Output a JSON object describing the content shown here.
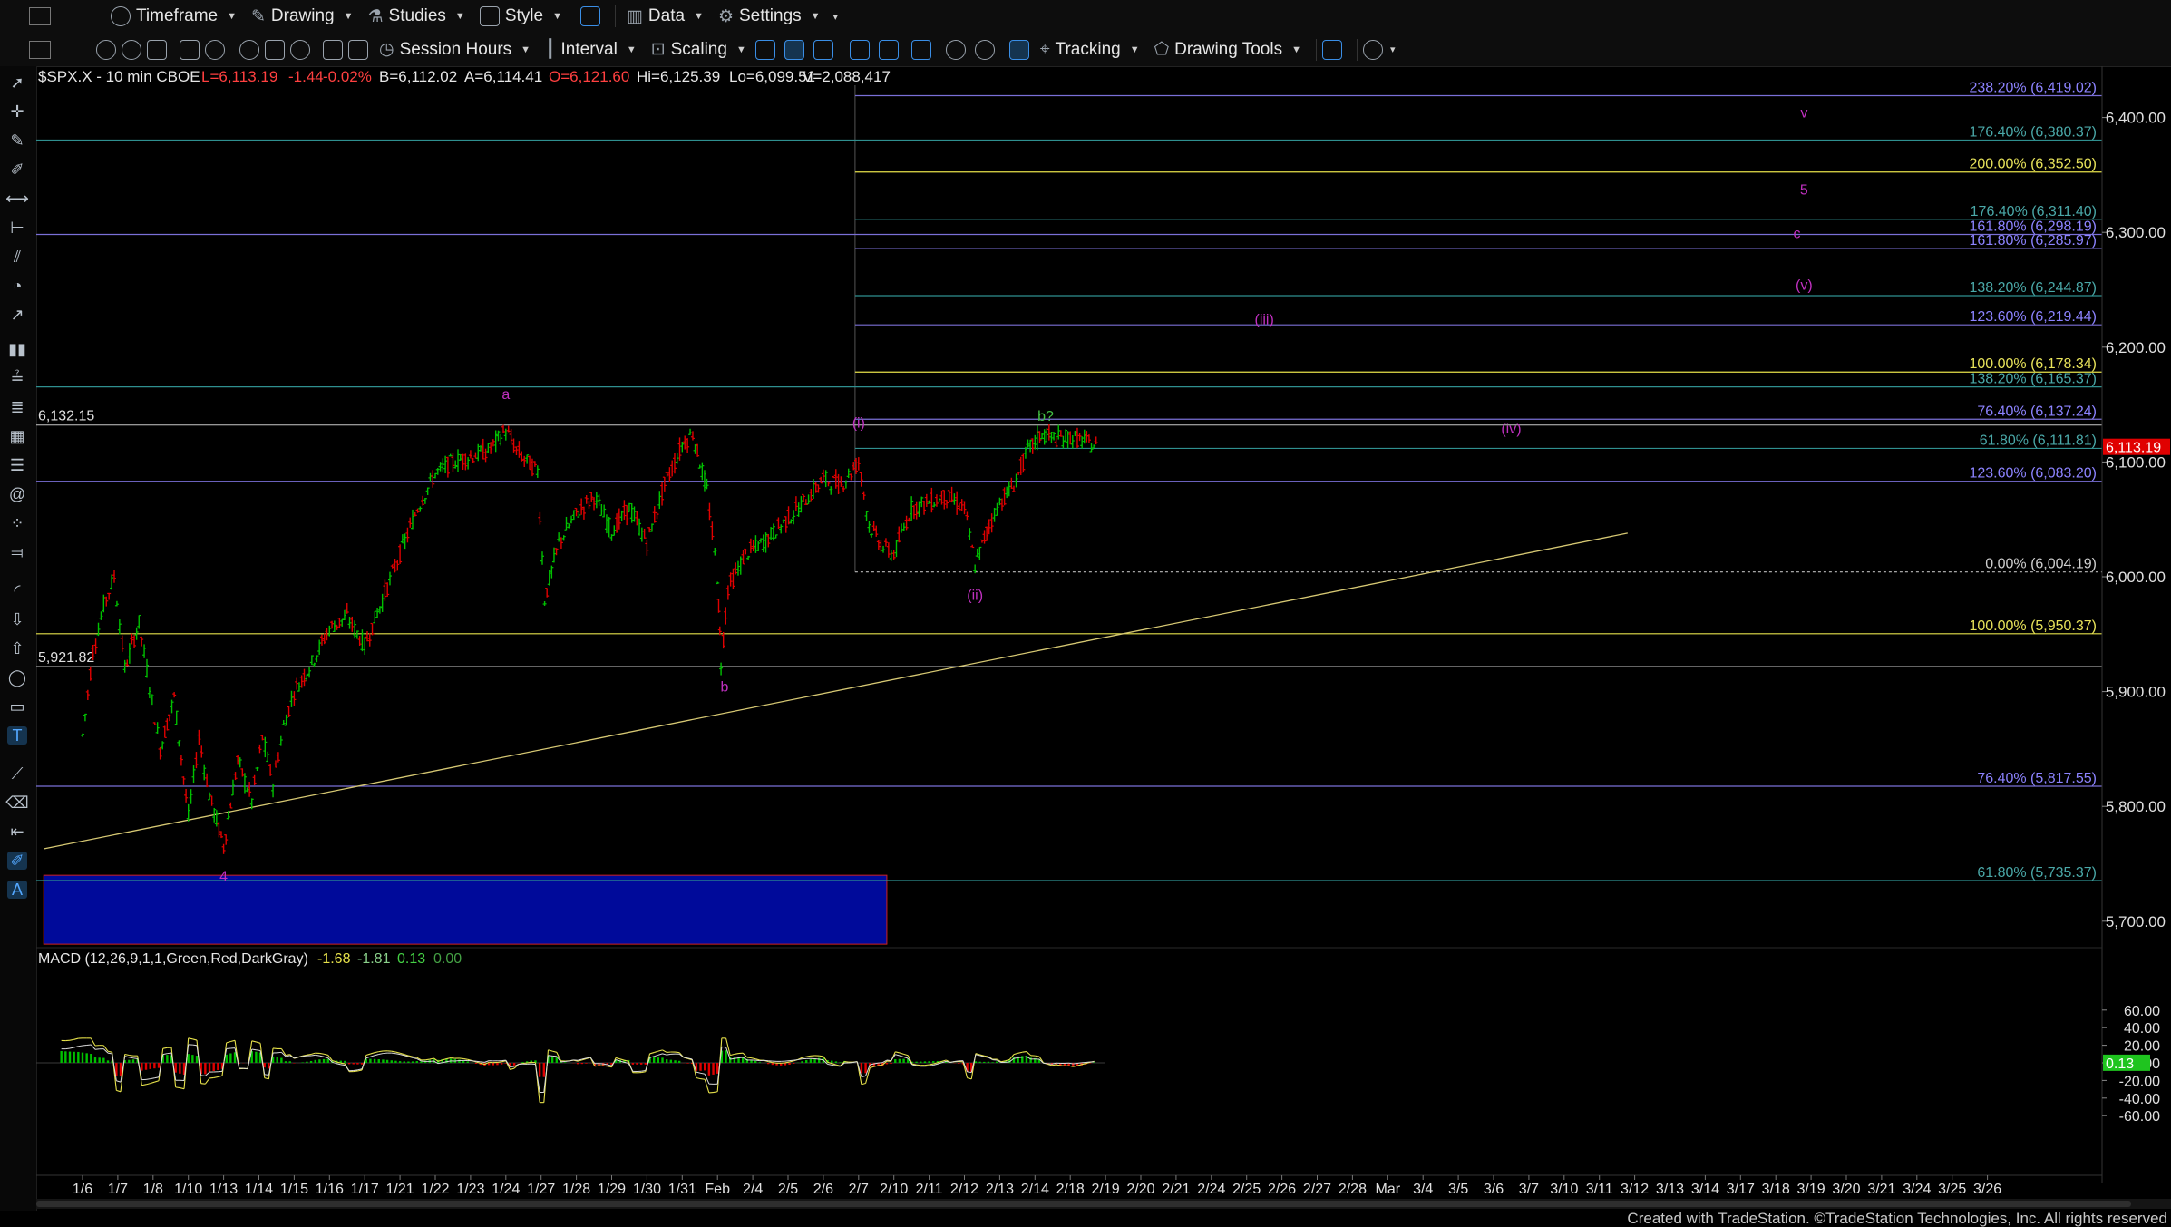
{
  "toolbar1": {
    "timeframe": "Timeframe",
    "drawing": "Drawing",
    "studies": "Studies",
    "style": "Style",
    "data": "Data",
    "settings": "Settings"
  },
  "toolbar2": {
    "session_hours": "Session Hours",
    "interval": "Interval",
    "scaling": "Scaling",
    "tracking": "Tracking",
    "drawing_tools": "Drawing Tools"
  },
  "symbol_bar": {
    "symbol": "$SPX.X - 10 min  CBOE",
    "last": "L=6,113.19",
    "change": "-1.44",
    "change_pct": "-0.02%",
    "bid": "B=6,112.02",
    "ask": "A=6,114.41",
    "open": "O=6,121.60",
    "high": "Hi=6,125.39",
    "low": "Lo=6,099.51",
    "volume": "V=2,088,417"
  },
  "colors": {
    "bg": "#000000",
    "up": "#00c000",
    "down": "#e00000",
    "fib_blue": "#7a6fd6",
    "fib_teal": "#2f8f8f",
    "fib_yellow": "#e6e14a",
    "wave_magenta": "#c030c0",
    "zone_blue": "#000a9a",
    "price_tag": "#e00000",
    "macd_tag": "#1fc41f"
  },
  "chart_data": {
    "type": "line",
    "title": "$SPX.X - 10 min",
    "x_axis_labels": [
      "1/6",
      "1/7",
      "1/8",
      "1/10",
      "1/13",
      "1/14",
      "1/15",
      "1/16",
      "1/17",
      "1/21",
      "1/22",
      "1/23",
      "1/24",
      "1/27",
      "1/28",
      "1/29",
      "1/30",
      "1/31",
      "Feb",
      "2/4",
      "2/5",
      "2/6",
      "2/7",
      "2/10",
      "2/11",
      "2/12",
      "2/13",
      "2/14",
      "2/18",
      "2/19",
      "2/20",
      "2/21",
      "2/24",
      "2/25",
      "2/26",
      "2/27",
      "2/28",
      "Mar",
      "3/4",
      "3/5",
      "3/6",
      "3/7",
      "3/10",
      "3/11",
      "3/12",
      "3/13",
      "3/14",
      "3/17",
      "3/18",
      "3/19",
      "3/20",
      "3/21",
      "3/24",
      "3/25",
      "3/26"
    ],
    "y_ticks": [
      "6,400.00",
      "6,300.00",
      "6,200.00",
      "6,100.00",
      "6,000.00",
      "5,900.00",
      "5,800.00",
      "5,700.00"
    ],
    "ylim": [
      5665,
      6480
    ],
    "last_price": "6,113.19",
    "price_path": [
      {
        "d": 0,
        "v": 5862
      },
      {
        "d": 0.3,
        "v": 5935
      },
      {
        "d": 0.6,
        "v": 5975
      },
      {
        "d": 0.9,
        "v": 6000
      },
      {
        "d": 1.2,
        "v": 5920
      },
      {
        "d": 1.6,
        "v": 5960
      },
      {
        "d": 2.2,
        "v": 5850
      },
      {
        "d": 2.6,
        "v": 5895
      },
      {
        "d": 3.0,
        "v": 5790
      },
      {
        "d": 3.3,
        "v": 5860
      },
      {
        "d": 3.6,
        "v": 5810
      },
      {
        "d": 4.0,
        "v": 5765
      },
      {
        "d": 4.4,
        "v": 5840
      },
      {
        "d": 4.8,
        "v": 5805
      },
      {
        "d": 5.1,
        "v": 5860
      },
      {
        "d": 5.4,
        "v": 5820
      },
      {
        "d": 5.7,
        "v": 5870
      },
      {
        "d": 6.0,
        "v": 5900
      },
      {
        "d": 6.5,
        "v": 5925
      },
      {
        "d": 7.0,
        "v": 5955
      },
      {
        "d": 7.5,
        "v": 5965
      },
      {
        "d": 8.0,
        "v": 5940
      },
      {
        "d": 8.5,
        "v": 5980
      },
      {
        "d": 9.0,
        "v": 6020
      },
      {
        "d": 9.5,
        "v": 6060
      },
      {
        "d": 10.0,
        "v": 6090
      },
      {
        "d": 10.5,
        "v": 6100
      },
      {
        "d": 11.0,
        "v": 6105
      },
      {
        "d": 11.5,
        "v": 6110
      },
      {
        "d": 12.0,
        "v": 6128
      },
      {
        "d": 12.3,
        "v": 6110
      },
      {
        "d": 12.6,
        "v": 6100
      },
      {
        "d": 12.9,
        "v": 6092
      },
      {
        "d": 13.1,
        "v": 5980
      },
      {
        "d": 13.5,
        "v": 6030
      },
      {
        "d": 14.0,
        "v": 6055
      },
      {
        "d": 14.5,
        "v": 6070
      },
      {
        "d": 15.0,
        "v": 6040
      },
      {
        "d": 15.5,
        "v": 6060
      },
      {
        "d": 16.0,
        "v": 6030
      },
      {
        "d": 16.5,
        "v": 6080
      },
      {
        "d": 17.0,
        "v": 6115
      },
      {
        "d": 17.3,
        "v": 6125
      },
      {
        "d": 17.7,
        "v": 6075
      },
      {
        "d": 18.0,
        "v": 6000
      },
      {
        "d": 18.1,
        "v": 5925
      },
      {
        "d": 18.3,
        "v": 5990
      },
      {
        "d": 18.8,
        "v": 6020
      },
      {
        "d": 19.3,
        "v": 6030
      },
      {
        "d": 19.8,
        "v": 6045
      },
      {
        "d": 20.3,
        "v": 6060
      },
      {
        "d": 21.0,
        "v": 6085
      },
      {
        "d": 21.5,
        "v": 6080
      },
      {
        "d": 22.0,
        "v": 6100
      },
      {
        "d": 22.3,
        "v": 6045
      },
      {
        "d": 22.7,
        "v": 6025
      },
      {
        "d": 23.0,
        "v": 6020
      },
      {
        "d": 23.5,
        "v": 6060
      },
      {
        "d": 24.0,
        "v": 6065
      },
      {
        "d": 24.5,
        "v": 6070
      },
      {
        "d": 25.0,
        "v": 6060
      },
      {
        "d": 25.3,
        "v": 6010
      },
      {
        "d": 25.7,
        "v": 6045
      },
      {
        "d": 26.0,
        "v": 6065
      },
      {
        "d": 26.4,
        "v": 6080
      },
      {
        "d": 26.8,
        "v": 6110
      },
      {
        "d": 27.2,
        "v": 6125
      },
      {
        "d": 27.6,
        "v": 6120
      },
      {
        "d": 28.0,
        "v": 6122
      },
      {
        "d": 28.4,
        "v": 6118
      },
      {
        "d": 28.8,
        "v": 6113
      }
    ],
    "fib_levels": [
      {
        "label": "238.20% (6,419.02)",
        "value": 6419.02,
        "color": "#7a6fd6",
        "text_color": "#8c83ff"
      },
      {
        "label": "176.40% (6,380.37)",
        "value": 6380.37,
        "color": "#2f8f8f",
        "text_color": "#4aa8a8"
      },
      {
        "label": "200.00% (6,352.50)",
        "value": 6352.5,
        "color": "#e6e14a",
        "text_color": "#e8e35a"
      },
      {
        "label": "176.40% (6,311.40)",
        "value": 6311.4,
        "color": "#2f8f8f",
        "text_color": "#4aa8a8"
      },
      {
        "label": "161.80% (6,298.19)",
        "value": 6298.19,
        "color": "#7a6fd6",
        "text_color": "#8c83ff"
      },
      {
        "label": "161.80% (6,285.97)",
        "value": 6285.97,
        "color": "#7a6fd6",
        "text_color": "#8c83ff"
      },
      {
        "label": "138.20% (6,244.87)",
        "value": 6244.87,
        "color": "#2f8f8f",
        "text_color": "#4aa8a8"
      },
      {
        "label": "123.60% (6,219.44)",
        "value": 6219.44,
        "color": "#7a6fd6",
        "text_color": "#8c83ff"
      },
      {
        "label": "100.00% (6,178.34)",
        "value": 6178.34,
        "color": "#e6e14a",
        "text_color": "#e8e35a"
      },
      {
        "label": "138.20% (6,165.37)",
        "value": 6165.37,
        "color": "#2f8f8f",
        "text_color": "#4aa8a8"
      },
      {
        "label": "76.40% (6,137.24)",
        "value": 6137.24,
        "color": "#7a6fd6",
        "text_color": "#8c83ff"
      },
      {
        "label": "61.80% (6,111.81)",
        "value": 6111.81,
        "color": "#2f8f8f",
        "text_color": "#4aa8a8"
      },
      {
        "label": "123.60% (6,083.20)",
        "value": 6083.2,
        "color": "#7a6fd6",
        "text_color": "#8c83ff"
      },
      {
        "label": "0.00% (6,004.19)",
        "value": 6004.19,
        "color": "#bbbbbb",
        "text_color": "#cfcfcf"
      },
      {
        "label": "100.00% (5,950.37)",
        "value": 5950.37,
        "color": "#e6e14a",
        "text_color": "#e8e35a"
      },
      {
        "label": "76.40% (5,817.55)",
        "value": 5817.55,
        "color": "#7a6fd6",
        "text_color": "#8c83ff"
      },
      {
        "label": "61.80% (5,735.37)",
        "value": 5735.37,
        "color": "#2f8f8f",
        "text_color": "#4aa8a8"
      }
    ],
    "left_levels": [
      {
        "label": "6,132.15",
        "value": 6132.15
      },
      {
        "label": "5,921.82",
        "value": 5921.82
      }
    ],
    "wave_labels": [
      {
        "text": "a",
        "d": 12.0,
        "v": 6155
      },
      {
        "text": "b",
        "d": 18.2,
        "v": 5900
      },
      {
        "text": "4",
        "d": 4.0,
        "v": 5735
      },
      {
        "text": "(i)",
        "d": 22.0,
        "v": 6130
      },
      {
        "text": "(ii)",
        "d": 25.3,
        "v": 5980
      },
      {
        "text": "b?",
        "d": 27.3,
        "v": 6136
      },
      {
        "text": "(iii)",
        "d": 33.5,
        "v": 6220
      },
      {
        "text": "(iv)",
        "d": 40.5,
        "v": 6125
      },
      {
        "text": "(v)",
        "d": 48.8,
        "v": 6250
      },
      {
        "text": "c",
        "d": 48.6,
        "v": 6295
      },
      {
        "text": "5",
        "d": 48.8,
        "v": 6333
      },
      {
        "text": "v",
        "d": 48.8,
        "v": 6400
      }
    ],
    "trendline": {
      "d1": -1.1,
      "v1": 5763,
      "d2": 43.8,
      "v2": 6038
    },
    "zone": {
      "d1": -1.1,
      "d2": 22.8,
      "v_top": 5740,
      "v_bottom": 5680
    },
    "macd": {
      "label": "MACD (12,26,9,1,1,Green,Red,DarkGray)",
      "macd_value": "-1.68",
      "signal_value": "-1.81",
      "hist_value": "0.13",
      "extra_value": "0.00",
      "y_ticks": [
        "60.00",
        "40.00",
        "20.00",
        "0.00",
        "-20.00",
        "-40.00",
        "-60.00"
      ],
      "ylim": [
        -70,
        68
      ],
      "tag": "0.13"
    }
  },
  "footer": "Created with TradeStation. ©TradeStation Technologies, Inc. All rights reserved"
}
